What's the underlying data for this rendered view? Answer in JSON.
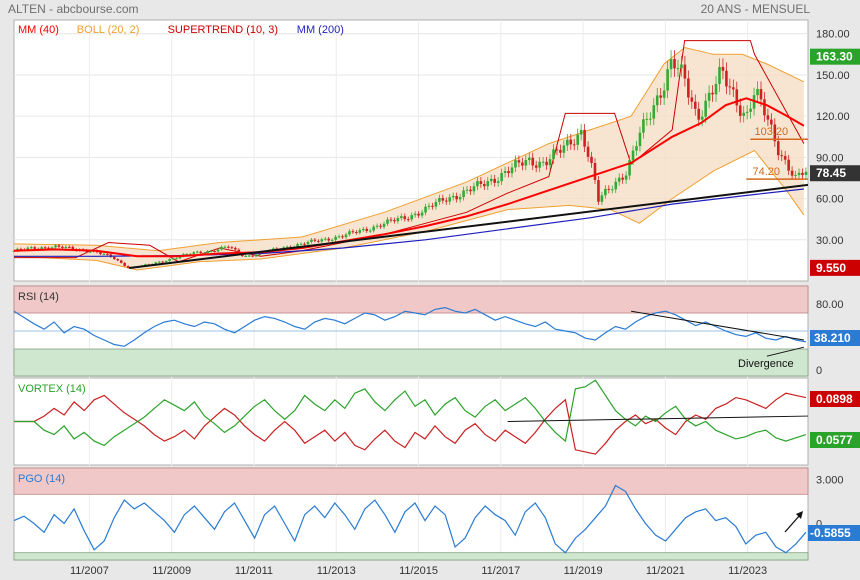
{
  "header": {
    "title": "ALTEN - abcbourse.com",
    "subtitle": "20 ANS - MENSUEL"
  },
  "colors": {
    "mm40": "#ff0000",
    "boll": "#f0a030",
    "supertrend": "#cc0000",
    "mm200": "#1f1fbf",
    "up_candle": "#33aa33",
    "down_candle": "#cc2222",
    "rsi": "#2a7bd4",
    "vortex_plus": "#2aa32a",
    "vortex_minus": "#cc1f1f",
    "pgo": "#2a7bd4",
    "zone_high": "#f0c8c8",
    "zone_low": "#cfe6cf",
    "level_line": "#d2691e"
  },
  "chart_data": [
    {
      "type": "candlestick",
      "panel": "price",
      "legend": [
        {
          "label": "MM (40)",
          "color": "#ff0000"
        },
        {
          "label": "BOLL (20, 2)",
          "color": "#f0a030"
        },
        {
          "label": "SUPERTREND (10, 3)",
          "color": "#cc0000"
        },
        {
          "label": "MM (200)",
          "color": "#1f1fbf"
        }
      ],
      "yticks": [
        "180.00",
        "150.00",
        "120.00",
        "90.00",
        "60.00",
        "30.00"
      ],
      "ylim": [
        0,
        190
      ],
      "xticks": [
        "11/2007",
        "11/2009",
        "11/2011",
        "11/2013",
        "11/2015",
        "11/2017",
        "11/2019",
        "11/2021",
        "11/2023"
      ],
      "x_range": [
        2006.0,
        2025.3
      ],
      "close_path": [
        [
          2006.0,
          22
        ],
        [
          2006.5,
          24
        ],
        [
          2007.0,
          25
        ],
        [
          2007.5,
          23
        ],
        [
          2007.9,
          22
        ],
        [
          2008.4,
          17
        ],
        [
          2008.8,
          9.5
        ],
        [
          2009.3,
          12
        ],
        [
          2009.8,
          16
        ],
        [
          2010.3,
          20
        ],
        [
          2010.8,
          22
        ],
        [
          2011.2,
          25
        ],
        [
          2011.6,
          18
        ],
        [
          2012.0,
          20
        ],
        [
          2012.5,
          24
        ],
        [
          2013.0,
          27
        ],
        [
          2013.5,
          30
        ],
        [
          2014.0,
          33
        ],
        [
          2014.5,
          37
        ],
        [
          2015.0,
          42
        ],
        [
          2015.5,
          46
        ],
        [
          2016.0,
          52
        ],
        [
          2016.5,
          60
        ],
        [
          2017.0,
          65
        ],
        [
          2017.5,
          72
        ],
        [
          2018.0,
          80
        ],
        [
          2018.5,
          88
        ],
        [
          2018.9,
          86
        ],
        [
          2019.3,
          95
        ],
        [
          2019.8,
          110
        ],
        [
          2020.1,
          75
        ],
        [
          2020.2,
          58
        ],
        [
          2020.6,
          72
        ],
        [
          2020.9,
          80
        ],
        [
          2021.2,
          105
        ],
        [
          2021.5,
          125
        ],
        [
          2021.8,
          145
        ],
        [
          2022.0,
          160
        ],
        [
          2022.3,
          145
        ],
        [
          2022.6,
          120
        ],
        [
          2022.9,
          135
        ],
        [
          2023.2,
          150
        ],
        [
          2023.5,
          135
        ],
        [
          2023.8,
          120
        ],
        [
          2024.0,
          138
        ],
        [
          2024.3,
          118
        ],
        [
          2024.6,
          95
        ],
        [
          2024.8,
          85
        ],
        [
          2025.0,
          74.2
        ],
        [
          2025.2,
          78.45
        ]
      ],
      "mm40_path": [
        [
          2006.0,
          22
        ],
        [
          2007.0,
          23
        ],
        [
          2008.0,
          22
        ],
        [
          2009.0,
          18
        ],
        [
          2010.0,
          18
        ],
        [
          2011.0,
          20
        ],
        [
          2012.0,
          21
        ],
        [
          2013.0,
          24
        ],
        [
          2014.0,
          29
        ],
        [
          2015.0,
          34
        ],
        [
          2016.0,
          40
        ],
        [
          2017.0,
          47
        ],
        [
          2018.0,
          56
        ],
        [
          2019.0,
          66
        ],
        [
          2020.0,
          76
        ],
        [
          2021.0,
          86
        ],
        [
          2022.0,
          105
        ],
        [
          2022.7,
          115
        ],
        [
          2023.3,
          128
        ],
        [
          2023.8,
          133
        ],
        [
          2024.3,
          128
        ],
        [
          2024.8,
          120
        ],
        [
          2025.2,
          113
        ]
      ],
      "mm200_path": [
        [
          2006.0,
          18
        ],
        [
          2008.0,
          18
        ],
        [
          2010.0,
          18.5
        ],
        [
          2012.0,
          20
        ],
        [
          2014.0,
          24
        ],
        [
          2016.0,
          30
        ],
        [
          2018.0,
          38
        ],
        [
          2020.0,
          46
        ],
        [
          2022.0,
          56
        ],
        [
          2024.0,
          63
        ],
        [
          2025.2,
          67
        ]
      ],
      "boll_upper_path": [
        [
          2006.0,
          27
        ],
        [
          2008.0,
          26
        ],
        [
          2009.5,
          22
        ],
        [
          2011.0,
          28
        ],
        [
          2013.0,
          32
        ],
        [
          2015.0,
          50
        ],
        [
          2017.0,
          72
        ],
        [
          2019.0,
          100
        ],
        [
          2020.0,
          110
        ],
        [
          2021.0,
          120
        ],
        [
          2021.8,
          158
        ],
        [
          2022.3,
          170
        ],
        [
          2023.0,
          165
        ],
        [
          2023.7,
          165
        ],
        [
          2024.3,
          158
        ],
        [
          2025.2,
          145
        ]
      ],
      "boll_lower_path": [
        [
          2006.0,
          18
        ],
        [
          2008.0,
          15
        ],
        [
          2009.0,
          8
        ],
        [
          2010.5,
          14
        ],
        [
          2012.0,
          16
        ],
        [
          2014.0,
          24
        ],
        [
          2016.0,
          36
        ],
        [
          2018.0,
          52
        ],
        [
          2019.5,
          55
        ],
        [
          2020.5,
          52
        ],
        [
          2021.2,
          42
        ],
        [
          2022.0,
          60
        ],
        [
          2023.0,
          80
        ],
        [
          2024.0,
          95
        ],
        [
          2024.8,
          65
        ],
        [
          2025.2,
          48
        ]
      ],
      "supertrend_path": [
        [
          2006.0,
          17
        ],
        [
          2007.5,
          17
        ],
        [
          2008.3,
          28
        ],
        [
          2009.3,
          26
        ],
        [
          2010.0,
          14
        ],
        [
          2011.0,
          24
        ],
        [
          2012.0,
          18
        ],
        [
          2013.0,
          22
        ],
        [
          2014.0,
          28
        ],
        [
          2015.0,
          34
        ],
        [
          2016.0,
          42
        ],
        [
          2017.0,
          50
        ],
        [
          2018.0,
          64
        ],
        [
          2019.0,
          76
        ],
        [
          2019.4,
          122
        ],
        [
          2020.6,
          122
        ],
        [
          2021.0,
          85
        ],
        [
          2022.0,
          110
        ],
        [
          2022.3,
          175
        ],
        [
          2023.9,
          175
        ],
        [
          2024.0,
          165
        ],
        [
          2025.2,
          100
        ]
      ],
      "trendline": [
        [
          2008.8,
          9.5
        ],
        [
          2025.3,
          70
        ]
      ],
      "levels": [
        {
          "value": 103.2,
          "label": "103.20"
        },
        {
          "value": 74.2,
          "label": "74.20"
        }
      ],
      "tags": [
        {
          "value": 163.3,
          "label": "163.30",
          "color": "#2aa32a"
        },
        {
          "value": 78.45,
          "label": "78.45",
          "color": "#333333"
        },
        {
          "value": 9.55,
          "label": "9.550",
          "color": "#cc0000"
        }
      ]
    },
    {
      "type": "line",
      "panel": "rsi",
      "title": "RSI (14)",
      "yticks": [
        "80.00",
        "0"
      ],
      "ylim": [
        0,
        100
      ],
      "zones": {
        "high": [
          70,
          100
        ],
        "low": [
          0,
          30
        ]
      },
      "value_label": "38.210",
      "annotation": "Divergence",
      "series": [
        {
          "values": [
            72,
            65,
            58,
            52,
            60,
            48,
            55,
            52,
            45,
            40,
            35,
            33,
            40,
            48,
            55,
            60,
            62,
            58,
            55,
            60,
            58,
            52,
            48,
            55,
            62,
            66,
            64,
            60,
            55,
            52,
            60,
            64,
            62,
            58,
            64,
            70,
            68,
            62,
            66,
            72,
            70,
            68,
            74,
            76,
            72,
            70,
            74,
            68,
            62,
            66,
            62,
            58,
            55,
            60,
            52,
            50,
            48,
            42,
            40,
            48,
            55,
            52,
            60,
            66,
            70,
            72,
            68,
            62,
            56,
            60,
            55,
            50,
            46,
            44,
            48,
            42,
            40,
            44,
            40,
            38
          ]
        }
      ],
      "divergence_lines": [
        [
          [
            2021.0,
            72
          ],
          [
            2025.2,
            40
          ]
        ],
        [
          [
            2024.3,
            22
          ],
          [
            2025.2,
            32
          ]
        ]
      ]
    },
    {
      "type": "line",
      "panel": "vortex",
      "title": "VORTEX (14)",
      "ylim": [
        0.6,
        1.4
      ],
      "value_labels": [
        {
          "label": "0.0898",
          "color": "#cc0000"
        },
        {
          "label": "0.0577",
          "color": "#2aa32a"
        }
      ],
      "series": [
        {
          "values": [
            1.0,
            1.0,
            1.0,
            0.92,
            0.88,
            0.96,
            0.84,
            0.9,
            0.82,
            0.78,
            0.86,
            0.92,
            0.98,
            1.04,
            1.12,
            1.2,
            1.15,
            1.1,
            1.18,
            1.05,
            0.98,
            0.9,
            0.96,
            1.05,
            1.14,
            1.2,
            1.1,
            1.02,
            1.1,
            1.24,
            1.16,
            1.1,
            1.2,
            1.12,
            1.26,
            1.3,
            1.18,
            1.1,
            1.2,
            1.28,
            1.14,
            1.2,
            1.06,
            1.16,
            1.22,
            1.1,
            1.04,
            1.14,
            1.2,
            1.1,
            1.16,
            1.22,
            1.12,
            1.0,
            0.9,
            0.82,
            1.3,
            1.32,
            1.38,
            1.24,
            1.1,
            1.02,
            0.96,
            1.05,
            1.0,
            1.08,
            1.14,
            1.02,
            0.96,
            1.0,
            0.92,
            0.88,
            0.84,
            0.86,
            0.9,
            0.92,
            0.85,
            0.82,
            0.85,
            0.88
          ]
        },
        {
          "values": [
            1.0,
            1.0,
            1.0,
            1.05,
            1.12,
            1.06,
            1.18,
            1.1,
            1.2,
            1.24,
            1.16,
            1.08,
            1.02,
            0.96,
            0.88,
            0.82,
            0.86,
            0.92,
            0.84,
            0.96,
            1.04,
            1.12,
            1.06,
            0.96,
            0.88,
            0.82,
            0.92,
            1.0,
            0.92,
            0.8,
            0.86,
            0.92,
            0.82,
            0.9,
            0.78,
            0.74,
            0.84,
            0.92,
            0.82,
            0.76,
            0.9,
            0.84,
            0.96,
            0.86,
            0.8,
            0.92,
            0.98,
            0.88,
            0.82,
            0.92,
            0.86,
            0.8,
            0.9,
            1.02,
            1.12,
            1.2,
            0.74,
            0.72,
            0.7,
            0.8,
            0.92,
            1.0,
            1.06,
            0.98,
            1.02,
            0.94,
            0.88,
            1.0,
            1.06,
            1.02,
            1.12,
            1.16,
            1.22,
            1.2,
            1.16,
            1.12,
            1.2,
            1.26,
            1.24,
            1.22
          ]
        }
      ],
      "trendline": [
        [
          2018.0,
          1.0
        ],
        [
          2025.3,
          1.05
        ]
      ]
    },
    {
      "type": "line",
      "panel": "pgo",
      "title": "PGO (14)",
      "yticks": [
        "3.000",
        "0"
      ],
      "ylim": [
        -2.5,
        3.8
      ],
      "zones": {
        "high": [
          2.0,
          3.8
        ],
        "low": [
          -2.5,
          -2.0
        ]
      },
      "value_label": "-0.5855",
      "series": [
        {
          "values": [
            0.2,
            0.5,
            0.0,
            -0.6,
            0.6,
            0.0,
            1.0,
            -0.5,
            -1.8,
            -1.2,
            0.4,
            1.6,
            1.0,
            1.4,
            0.8,
            0.2,
            -0.6,
            0.6,
            1.2,
            0.4,
            -0.4,
            0.8,
            1.4,
            0.2,
            -1.0,
            0.6,
            1.2,
            0.0,
            -1.2,
            0.6,
            1.2,
            0.4,
            1.4,
            0.6,
            -0.4,
            1.0,
            1.6,
            0.6,
            -0.6,
            0.8,
            1.4,
            0.2,
            1.2,
            0.6,
            -1.6,
            -1.0,
            0.4,
            1.2,
            0.6,
            0.2,
            -0.8,
            0.8,
            1.4,
            0.4,
            -1.4,
            -2.0,
            -1.0,
            -0.4,
            0.4,
            1.2,
            2.6,
            2.2,
            1.0,
            0.0,
            -0.8,
            -1.2,
            -0.4,
            0.4,
            0.8,
            1.0,
            0.2,
            0.4,
            -0.2,
            -1.4,
            -0.8,
            -0.6,
            -1.6,
            -2.0,
            -1.4,
            -0.6
          ]
        }
      ]
    }
  ]
}
